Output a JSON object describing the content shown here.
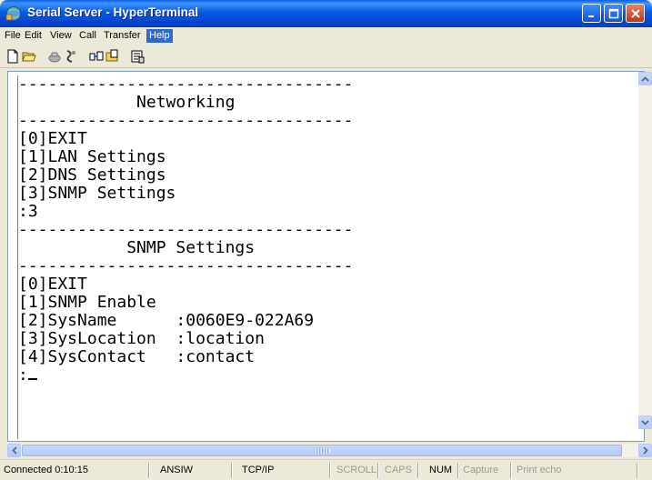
{
  "window": {
    "title": "Serial Server - HyperTerminal"
  },
  "menu": {
    "items": [
      "File",
      "Edit",
      "View",
      "Call",
      "Transfer",
      "Help"
    ]
  },
  "toolbar": {
    "icons": [
      "new-document-icon",
      "open-folder-icon",
      "call-icon",
      "disconnect-icon",
      "send-icon",
      "receive-icon",
      "properties-icon"
    ]
  },
  "terminal": {
    "lines": [
      "----------------------------------",
      "            Networking",
      "----------------------------------",
      "[0]EXIT",
      "[1]LAN Settings",
      "[2]DNS Settings",
      "[3]SNMP Settings",
      ":3",
      "----------------------------------",
      "           SNMP Settings",
      "----------------------------------",
      "[0]EXIT",
      "[1]SNMP Enable",
      "[2]SysName      :0060E9-022A69",
      "[3]SysLocation  :location",
      "[4]SysContact   :contact",
      ":"
    ]
  },
  "status": {
    "connected": "Connected 0:10:15",
    "emulation": "ANSIW",
    "port": "TCP/IP",
    "scroll": "SCROLL",
    "caps": "CAPS",
    "num": "NUM",
    "capture": "Capture",
    "print_echo": "Print echo"
  },
  "colors": {
    "title_bar": "#0a5ae0",
    "close_button": "#c2350f",
    "menu_highlight": "#316ac5"
  }
}
